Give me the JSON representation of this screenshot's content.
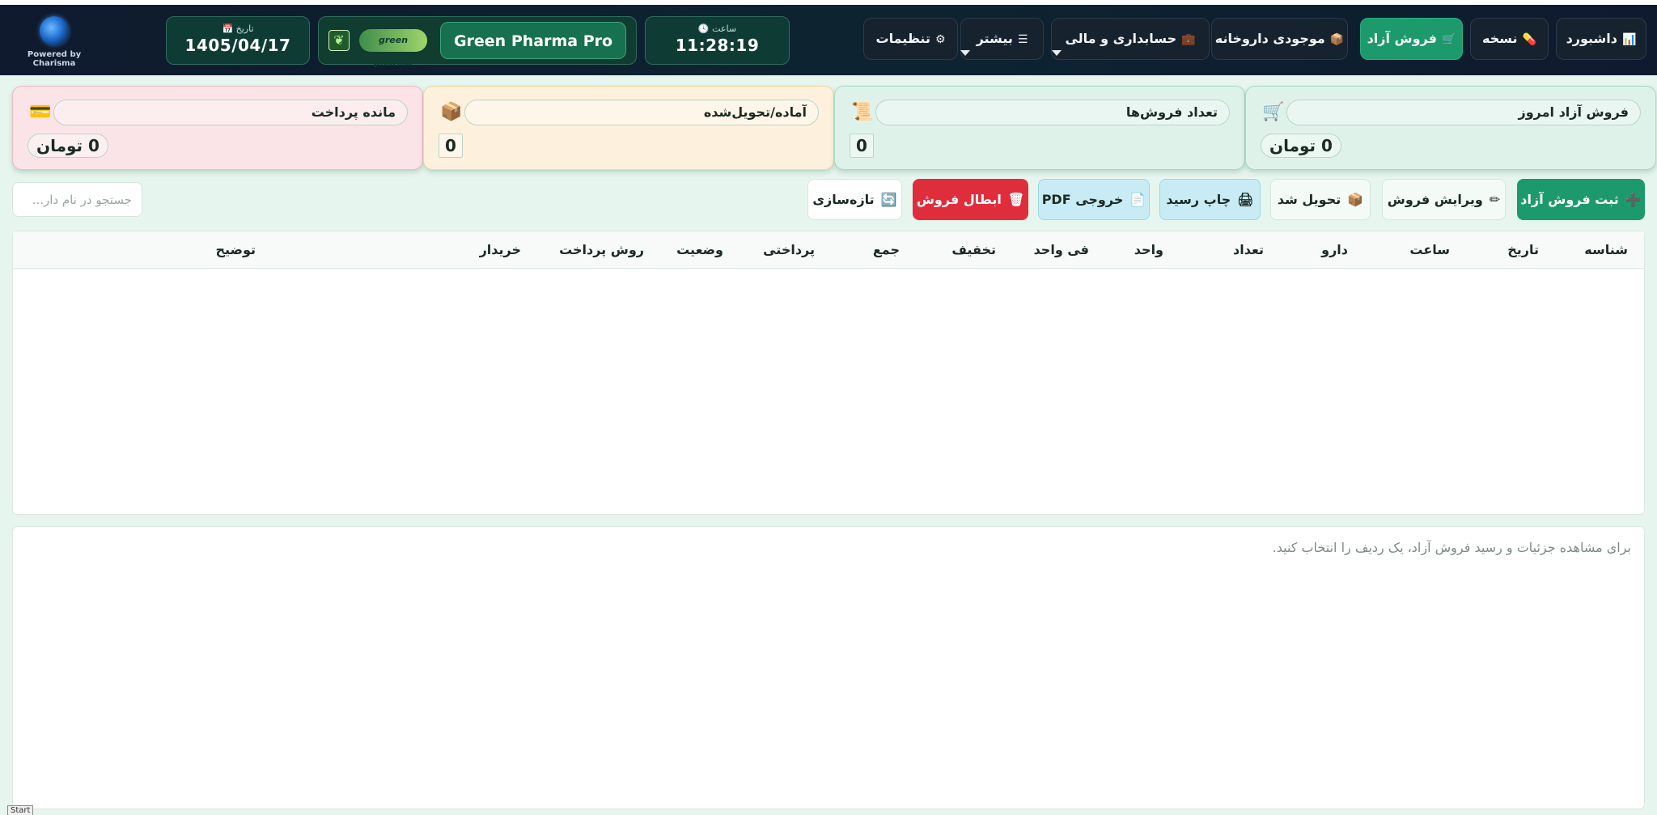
{
  "header": {
    "powered_by": "Powered by Charisma",
    "date_label": "📅 تاریخ",
    "date_value": "1405/04/17",
    "clock_label": "🕓 ساعت",
    "clock_value": "11:28:19",
    "pharma_logo_text": "green pharma",
    "pharma_name": "Green Pharma Pro",
    "nav": [
      {
        "label": "داشبورد",
        "icon": "📊",
        "active": false
      },
      {
        "label": "نسخه",
        "icon": "💊",
        "active": false
      },
      {
        "label": "فروش آزاد",
        "icon": "🛒",
        "active": true
      },
      {
        "label": "موجودی داروخانه",
        "icon": "📦",
        "active": false
      },
      {
        "label": "حسابداری و مالی",
        "icon": "💼",
        "active": false
      },
      {
        "label": "بیشتر",
        "icon": "☰",
        "active": false
      },
      {
        "label": "تنظیمات",
        "icon": "⚙",
        "active": false
      }
    ]
  },
  "stats": [
    {
      "title": "فروش آزاد امروز",
      "icon": "🛒",
      "value": "0 تومان"
    },
    {
      "title": "تعداد فروش‌ها",
      "icon": "📜",
      "value": "0"
    },
    {
      "title": "آماده/تحویل‌شده",
      "icon": "📦",
      "value": "0"
    },
    {
      "title": "مانده پرداخت",
      "icon": "💳",
      "value": "0 تومان"
    }
  ],
  "actions": [
    {
      "label": "ثبت فروش آزاد",
      "icon": "➕"
    },
    {
      "label": "ویرایش فروش",
      "icon": "✏"
    },
    {
      "label": "تحویل شد",
      "icon": "📦"
    },
    {
      "label": "چاپ رسید",
      "icon": "🖨"
    },
    {
      "label": "خروجی PDF",
      "icon": "📄"
    },
    {
      "label": "ابطال فروش",
      "icon": "🗑"
    },
    {
      "label": "تازه‌سازی",
      "icon": "🔄"
    }
  ],
  "search": {
    "placeholder": "جستجو در نام دار..."
  },
  "table": {
    "columns": [
      "شناسه",
      "تاریخ",
      "ساعت",
      "دارو",
      "تعداد",
      "واحد",
      "فی واحد",
      "تخفیف",
      "جمع",
      "پرداختی",
      "وضعیت",
      "روش پرداخت",
      "خریدار",
      "توضیح"
    ],
    "rows": []
  },
  "detail": {
    "message": "برای مشاهده جزئیات و رسید فروش آزاد، یک ردیف را انتخاب کنید."
  },
  "taskbar": {
    "start_label": "Start"
  },
  "colors": {
    "header_bg": "#0f1a2e",
    "accent_green": "#1d9a6c",
    "danger_red": "#e02d3c",
    "page_bg": "#e6f5ee"
  }
}
